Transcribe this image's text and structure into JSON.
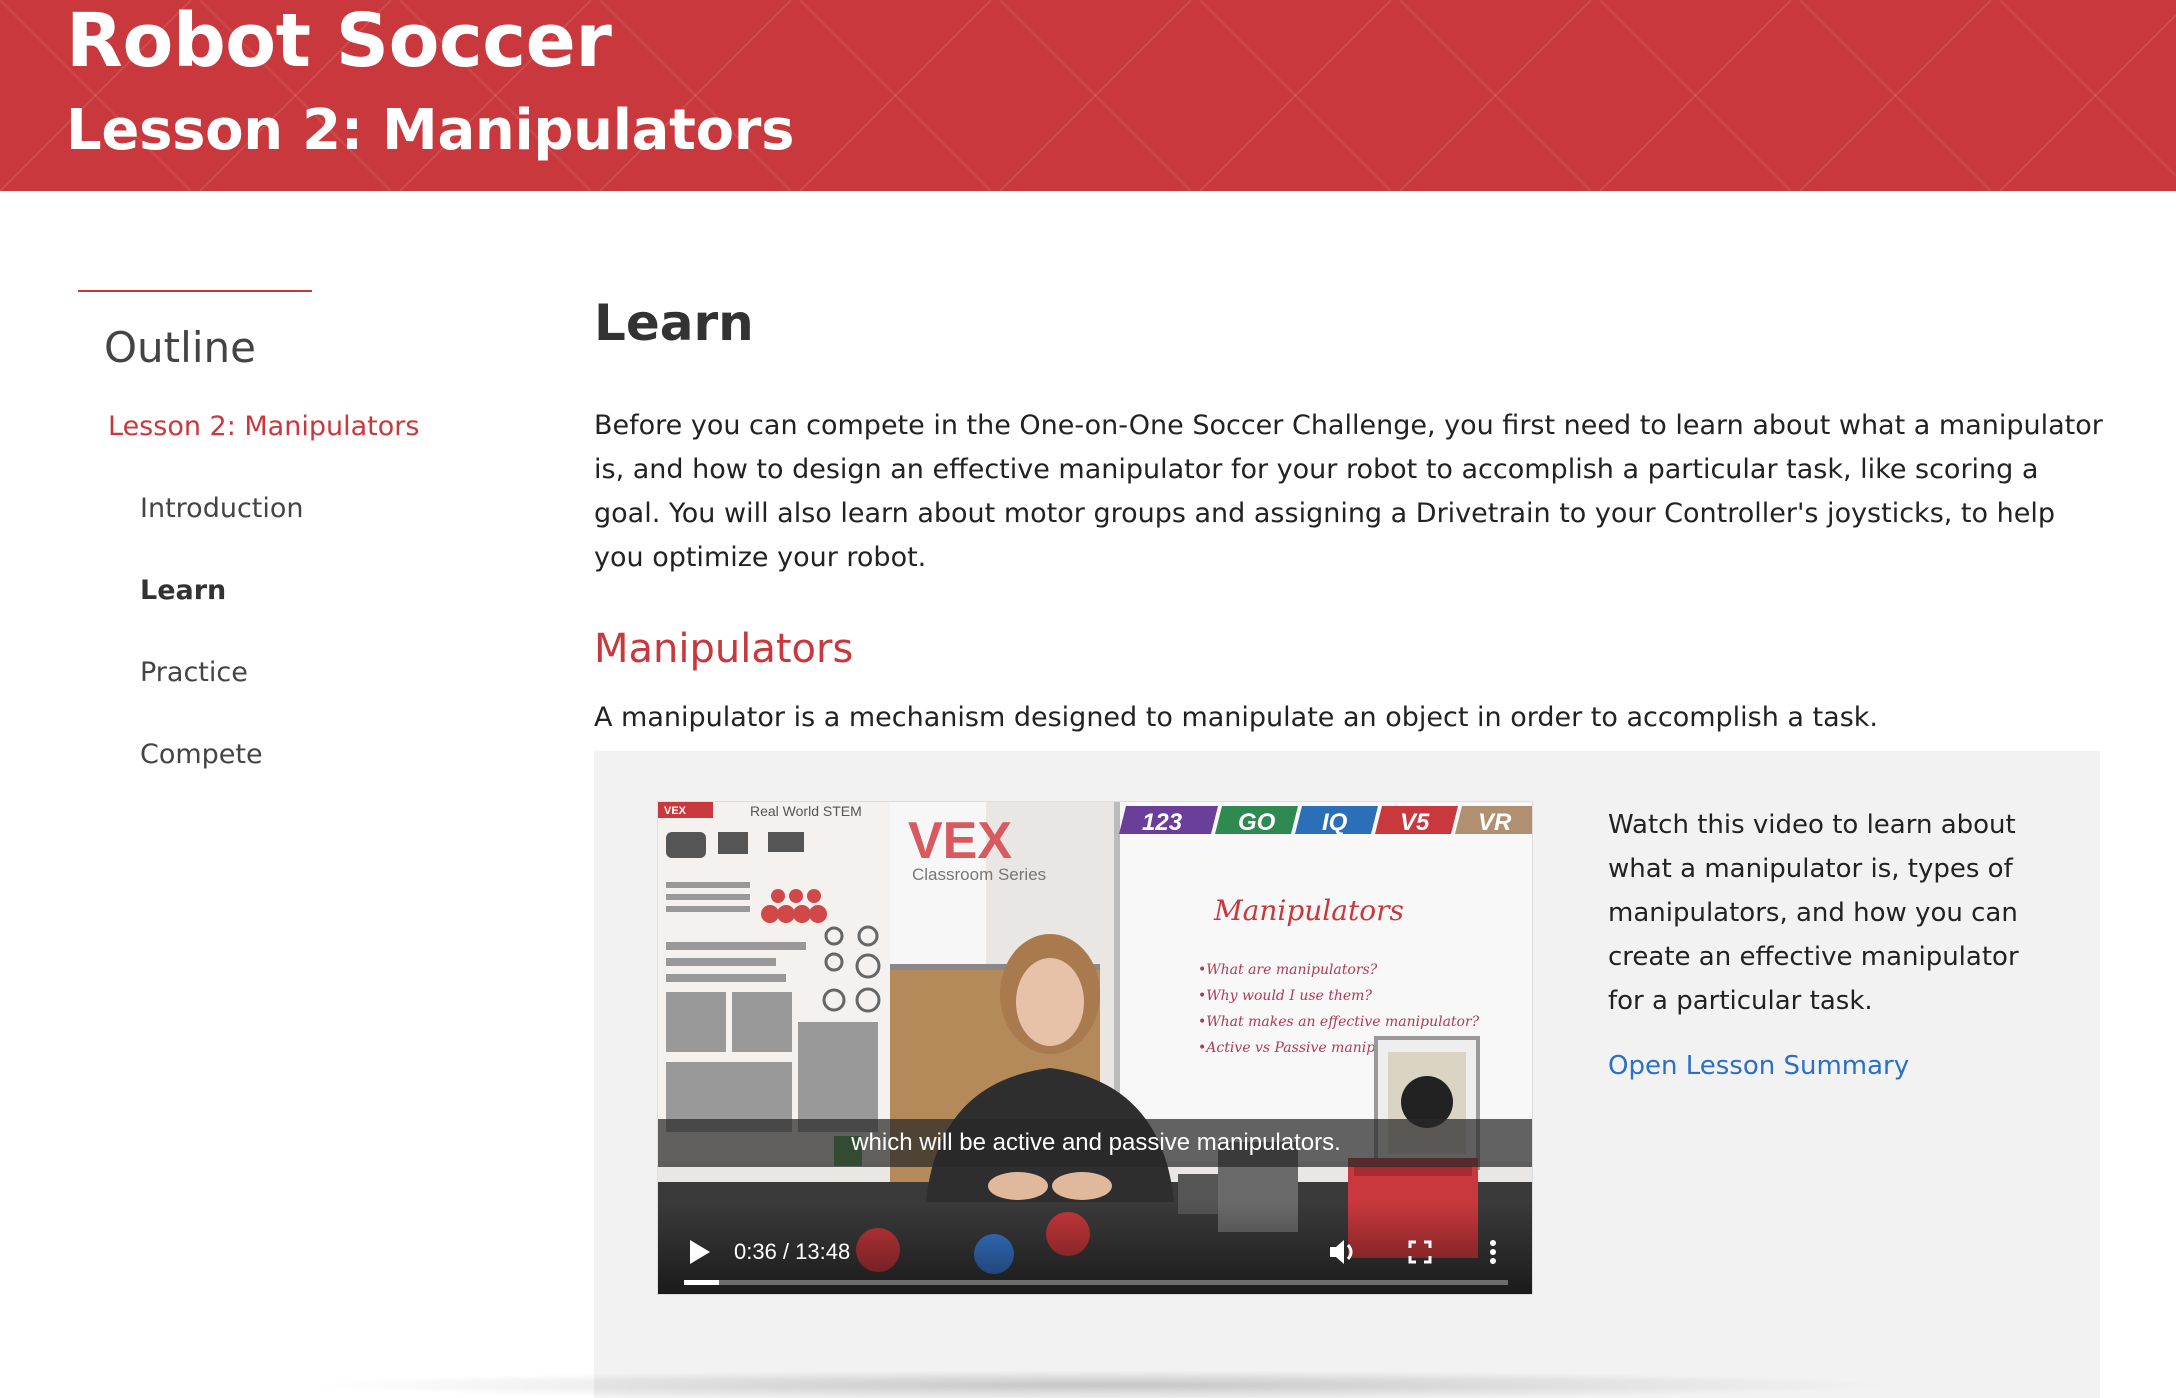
{
  "header": {
    "title": "Robot Soccer",
    "subtitle": "Lesson 2: Manipulators"
  },
  "sidebar": {
    "title": "Outline",
    "lesson_link": "Lesson 2: Manipulators",
    "items": [
      {
        "label": "Introduction",
        "active": false
      },
      {
        "label": "Learn",
        "active": true
      },
      {
        "label": "Practice",
        "active": false
      },
      {
        "label": "Compete",
        "active": false
      }
    ]
  },
  "main": {
    "heading": "Learn",
    "intro": "Before you can compete in the One-on-One Soccer Challenge, you first need to learn about what a manipulator is, and how to design an effective manipulator for your robot to accomplish a particular task, like scoring a goal. You will also learn about motor groups and assigning a Drivetrain to your Controller's joysticks, to help you optimize your robot.",
    "section_heading": "Manipulators",
    "definition": "A manipulator is a mechanism designed to manipulate an object in order to accomplish a task."
  },
  "video": {
    "caption": "which will be active and passive manipulators.",
    "time": "0:36 / 13:48",
    "progress": 0.043,
    "poster_text": {
      "brand": "VEX",
      "series": "Classroom Series",
      "poster_header": "Real World STEM",
      "product_tabs": [
        "123",
        "GO",
        "IQ",
        "V5",
        "VR"
      ],
      "whiteboard_title": "Manipulators",
      "whiteboard_lines": [
        "•What are manipulators?",
        "•Why would I use them?",
        "•What makes an effective manipulator?",
        "•Active vs Passive manipulators"
      ]
    }
  },
  "video_side": {
    "description": "Watch this video to learn about what a manipulator is, types of manipulators, and how you can create an effective manipulator for a particular task.",
    "link": "Open Lesson Summary"
  },
  "colors": {
    "brand_red": "#c8383c",
    "link_blue": "#2a6fc9",
    "panel_gray": "#f2f2f2"
  }
}
